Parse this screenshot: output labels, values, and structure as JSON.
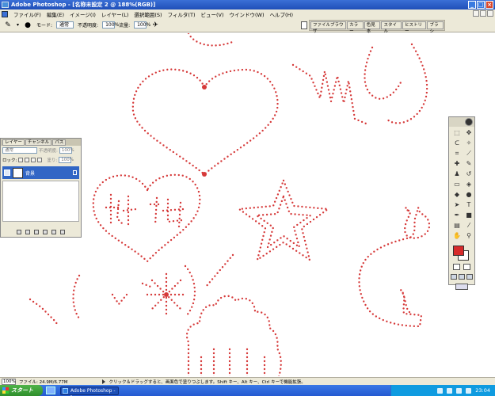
{
  "window": {
    "title": "Adobe Photoshop - [名称未設定 2 @ 188%(RGB)]"
  },
  "menu": [
    "ファイル(F)",
    "編集(E)",
    "イメージ(I)",
    "レイヤー(L)",
    "選択範囲(S)",
    "フィルタ(T)",
    "ビュー(V)",
    "ウインドウ(W)",
    "ヘルプ(H)"
  ],
  "options": {
    "mode_label": "モード:",
    "mode_value": "通常",
    "opacity_label": "不透明度:",
    "opacity_value": "100%",
    "flow_label": "流量:",
    "flow_value": "100%"
  },
  "palette_well": [
    "ファイルブラウザ",
    "カラー",
    "色見本",
    "スタイル",
    "ヒストリー",
    "ブラシ"
  ],
  "layers_panel": {
    "tabs": [
      "レイヤー",
      "チャンネル",
      "パス"
    ],
    "blend_mode": "通常",
    "opacity_label": "不透明度:",
    "opacity_value": "100%",
    "lock_label": "ロック:",
    "fill_label": "塗り:",
    "fill_value": "100%",
    "layer_name": "背景"
  },
  "status": {
    "zoom": "100%",
    "doc_info": "ファイル: 24.9M/6.77M",
    "hint": "クリック＆ドラッグすると、画面色で塗りつぶします。Shift キー、Alt キー、Ctrl キーで機能拡張。"
  },
  "taskbar": {
    "start": "スタート",
    "app": "Adobe Photoshop - [",
    "clock": "23:04"
  },
  "colors": {
    "foreground": "#d62a2a",
    "background": "#ffffff",
    "dot": "#d63a3a"
  }
}
